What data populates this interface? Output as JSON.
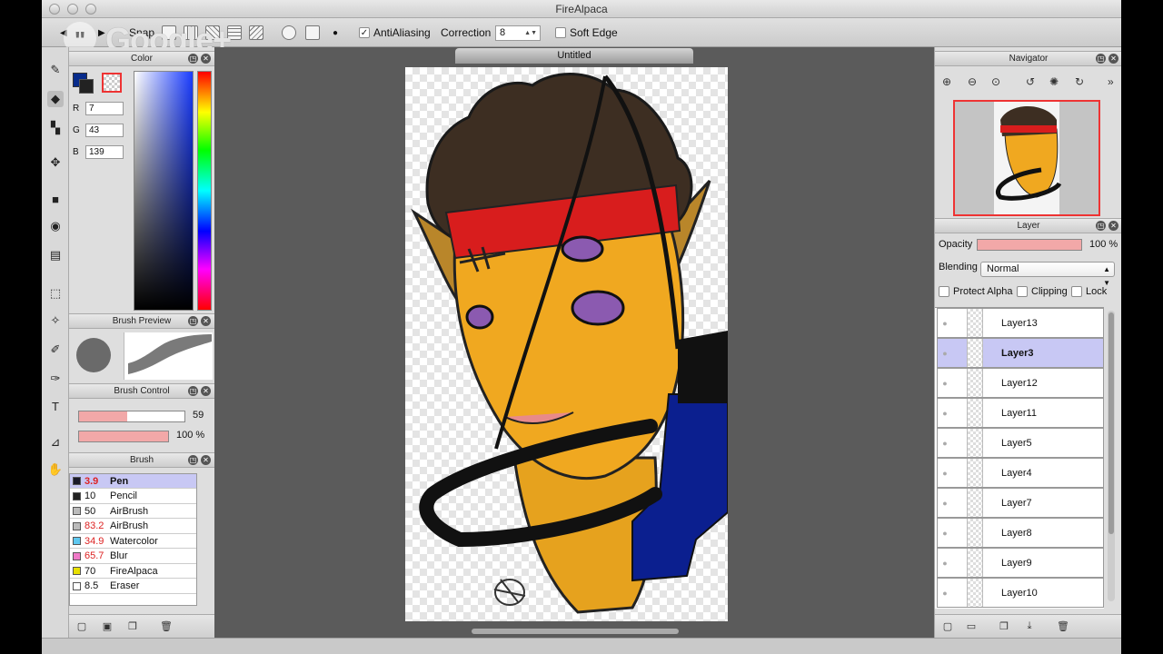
{
  "window": {
    "title": "FireAlpaca"
  },
  "overlay": {
    "bubble_text": "\"",
    "text": "Google+"
  },
  "toolbar": {
    "snap_label": "Snap",
    "antialiasing_label": "AntiAliasing",
    "antialiasing_checked": "✓",
    "correction_label": "Correction",
    "correction_value": "8",
    "soft_edge_label": "Soft Edge"
  },
  "color_panel": {
    "title": "Color",
    "current_color": "#072b8b",
    "r_label": "R",
    "r_value": "7",
    "g_label": "G",
    "g_value": "43",
    "b_label": "B",
    "b_value": "139"
  },
  "brush_preview": {
    "title": "Brush Preview"
  },
  "brush_control": {
    "title": "Brush Control",
    "size_value": "59",
    "size_fraction": 0.46,
    "opacity_value": "100 %",
    "opacity_fraction": 1.0
  },
  "brush_panel": {
    "title": "Brush",
    "items": [
      {
        "size": "3.9",
        "name": "Pen",
        "color": "#1a1a2a",
        "red": true,
        "selected": true
      },
      {
        "size": "10",
        "name": "Pencil",
        "color": "#222222",
        "red": false,
        "selected": false
      },
      {
        "size": "50",
        "name": "AirBrush",
        "color": "#bbbbbb",
        "red": false,
        "selected": false
      },
      {
        "size": "83.2",
        "name": "AirBrush",
        "color": "#bbbbbb",
        "red": true,
        "selected": false
      },
      {
        "size": "34.9",
        "name": "Watercolor",
        "color": "#5ec8f0",
        "red": true,
        "selected": false
      },
      {
        "size": "65.7",
        "name": "Blur",
        "color": "#f07ac8",
        "red": true,
        "selected": false
      },
      {
        "size": "70",
        "name": "FireAlpaca",
        "color": "#e8e000",
        "red": false,
        "selected": false
      },
      {
        "size": "8.5",
        "name": "Eraser",
        "color": "#ffffff",
        "red": false,
        "selected": false
      }
    ]
  },
  "document": {
    "tab_title": "Untitled"
  },
  "navigator": {
    "title": "Navigator"
  },
  "layer_panel": {
    "title": "Layer",
    "opacity_label": "Opacity",
    "opacity_value": "100 %",
    "blending_label": "Blending",
    "blending_value": "Normal",
    "protect_alpha_label": "Protect Alpha",
    "clipping_label": "Clipping",
    "lock_label": "Lock",
    "layers": [
      {
        "name": "Layer13",
        "selected": false
      },
      {
        "name": "Layer3",
        "selected": true
      },
      {
        "name": "Layer12",
        "selected": false
      },
      {
        "name": "Layer11",
        "selected": false
      },
      {
        "name": "Layer5",
        "selected": false
      },
      {
        "name": "Layer4",
        "selected": false
      },
      {
        "name": "Layer7",
        "selected": false
      },
      {
        "name": "Layer8",
        "selected": false
      },
      {
        "name": "Layer9",
        "selected": false
      },
      {
        "name": "Layer10",
        "selected": false
      }
    ]
  }
}
